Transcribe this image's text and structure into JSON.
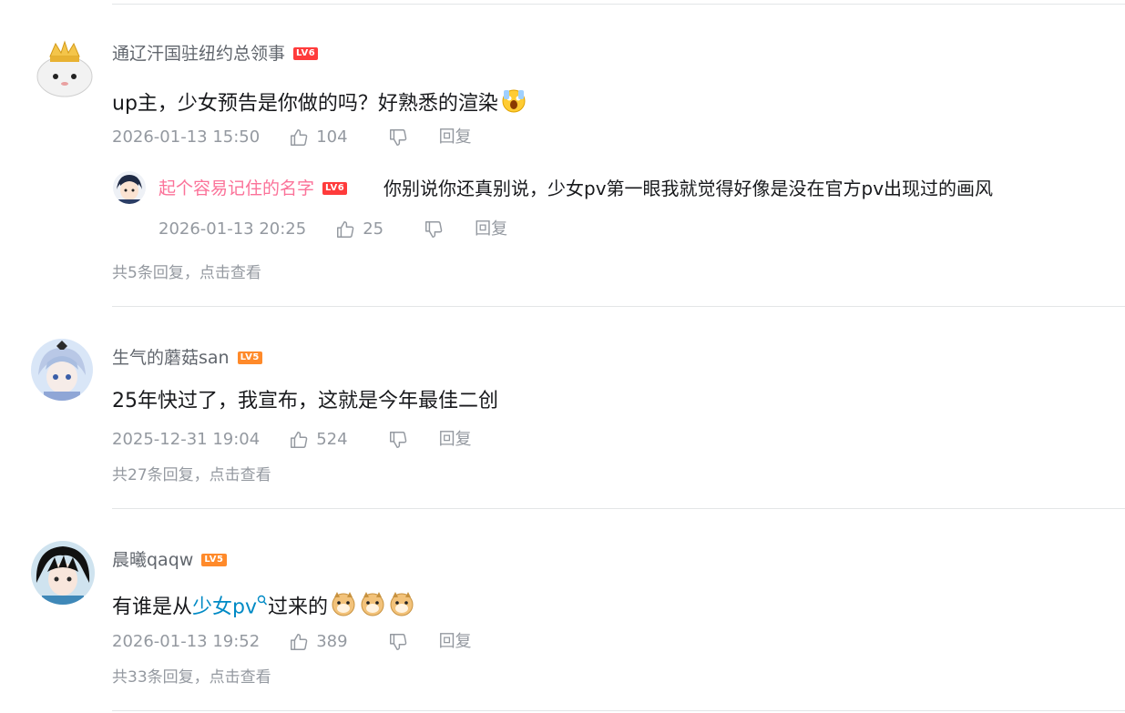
{
  "comments": [
    {
      "username": "通辽汗国驻纽约总领事",
      "level": "LV6",
      "content": "up主，少女预告是你做的吗？好熟悉的渲染",
      "timestamp": "2026-01-13 15:50",
      "likes": "104",
      "reply_label": "回复",
      "reply": {
        "username": "起个容易记住的名字",
        "level": "LV6",
        "content": "你别说你还真别说，少女pv第一眼我就觉得好像是没在官方pv出现过的画风",
        "timestamp": "2026-01-13 20:25",
        "likes": "25",
        "reply_label": "回复"
      },
      "more_replies": "共5条回复，点击查看"
    },
    {
      "username": "生气的蘑菇san",
      "level": "LV5",
      "content": "25年快过了，我宣布，这就是今年最佳二创",
      "timestamp": "2025-12-31 19:04",
      "likes": "524",
      "reply_label": "回复",
      "more_replies": "共27条回复，点击查看"
    },
    {
      "username": "晨曦qaqw",
      "level": "LV5",
      "content_before": "有谁是从",
      "content_link": "少女pv",
      "content_after": "过来的",
      "timestamp": "2026-01-13 19:52",
      "likes": "389",
      "reply_label": "回复",
      "more_replies": "共33条回复，点击查看"
    }
  ],
  "colors": {
    "pink_username": "#fb7299",
    "link": "#008ac5",
    "level6": "#ff3b3b",
    "level5": "#ff8a2a",
    "meta_text": "#9499a0"
  },
  "icons": [
    "thumbs-up-icon",
    "thumbs-down-icon",
    "search-icon",
    "scream-emoji",
    "doge-emoji"
  ]
}
